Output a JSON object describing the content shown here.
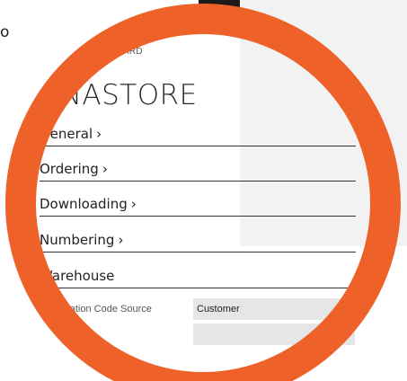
{
  "background": {
    "stray_text": "o"
  },
  "header": {
    "breadcrumb": "GROUP CARD",
    "breadcrumb_partial": "UP CARD",
    "record_title": "ANASTORE"
  },
  "sections": [
    {
      "label": "General",
      "chevron": "›"
    },
    {
      "label": "Ordering",
      "chevron": "›"
    },
    {
      "label": "Downloading",
      "chevron": "›"
    },
    {
      "label": "Numbering",
      "chevron": "›"
    },
    {
      "label": "Warehouse",
      "chevron": ""
    }
  ],
  "warehouse_fields": [
    {
      "label": "Location Code Source",
      "value": "Customer"
    },
    {
      "label": "",
      "value": ""
    }
  ],
  "colors": {
    "ring": "#ee6128",
    "field_bg": "#e6e6e6",
    "panel_bg": "#f2f2f2"
  }
}
